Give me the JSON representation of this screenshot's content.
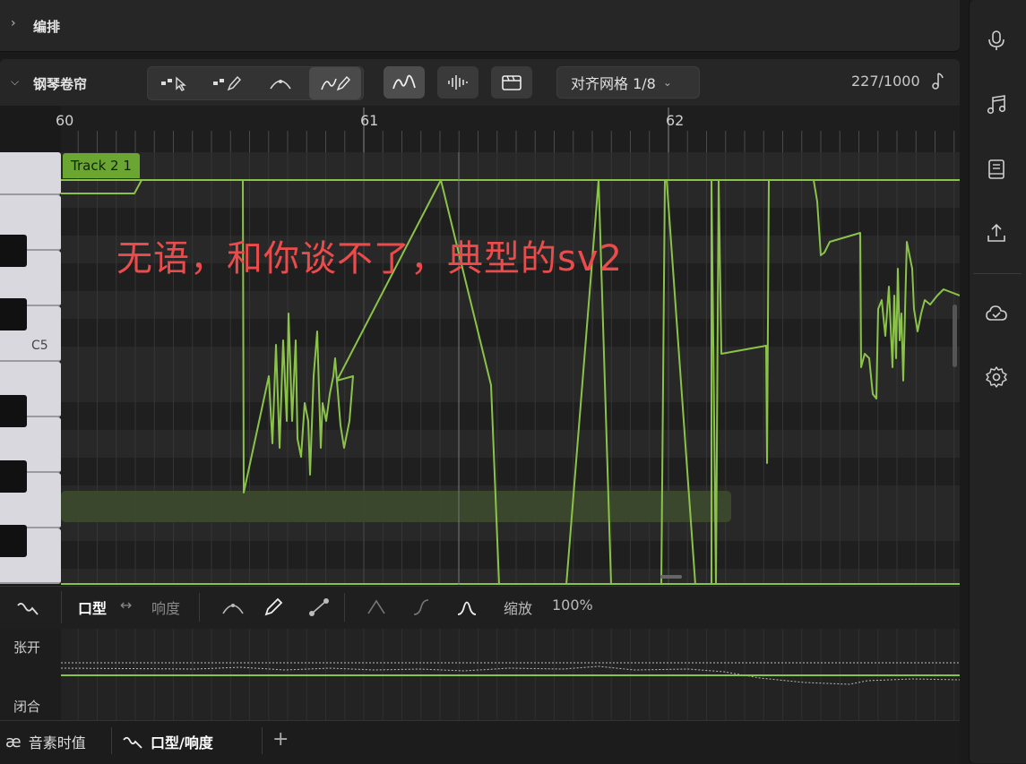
{
  "arrange": {
    "title": "编排"
  },
  "piano_roll": {
    "title": "钢琴卷帘",
    "snap_label": "对齐网格 1/8",
    "counter": "227/1000",
    "bar_labels": [
      "60",
      "61",
      "62"
    ],
    "key_label": "C5",
    "track_tag": "Track 2 1",
    "overlay_text": "无语，和你谈不了，典型的sv2"
  },
  "param_bar": {
    "mode_left": "口型",
    "mode_right": "响度",
    "zoom_label": "缩放",
    "zoom_value": "100%"
  },
  "param_labels": {
    "open": "张开",
    "close": "闭合"
  },
  "bottom_tabs": {
    "tab1": "音素时值",
    "tab2": "口型/响度",
    "add": "+"
  },
  "icons": {
    "sidebar": [
      "microphone-icon",
      "music-notes-icon",
      "book-icon",
      "upload-icon",
      "cloud-icon",
      "settings-icon"
    ]
  },
  "colors": {
    "accent": "#8bc34a",
    "overlay": "#ec4b4b",
    "track": "#6ca632"
  }
}
